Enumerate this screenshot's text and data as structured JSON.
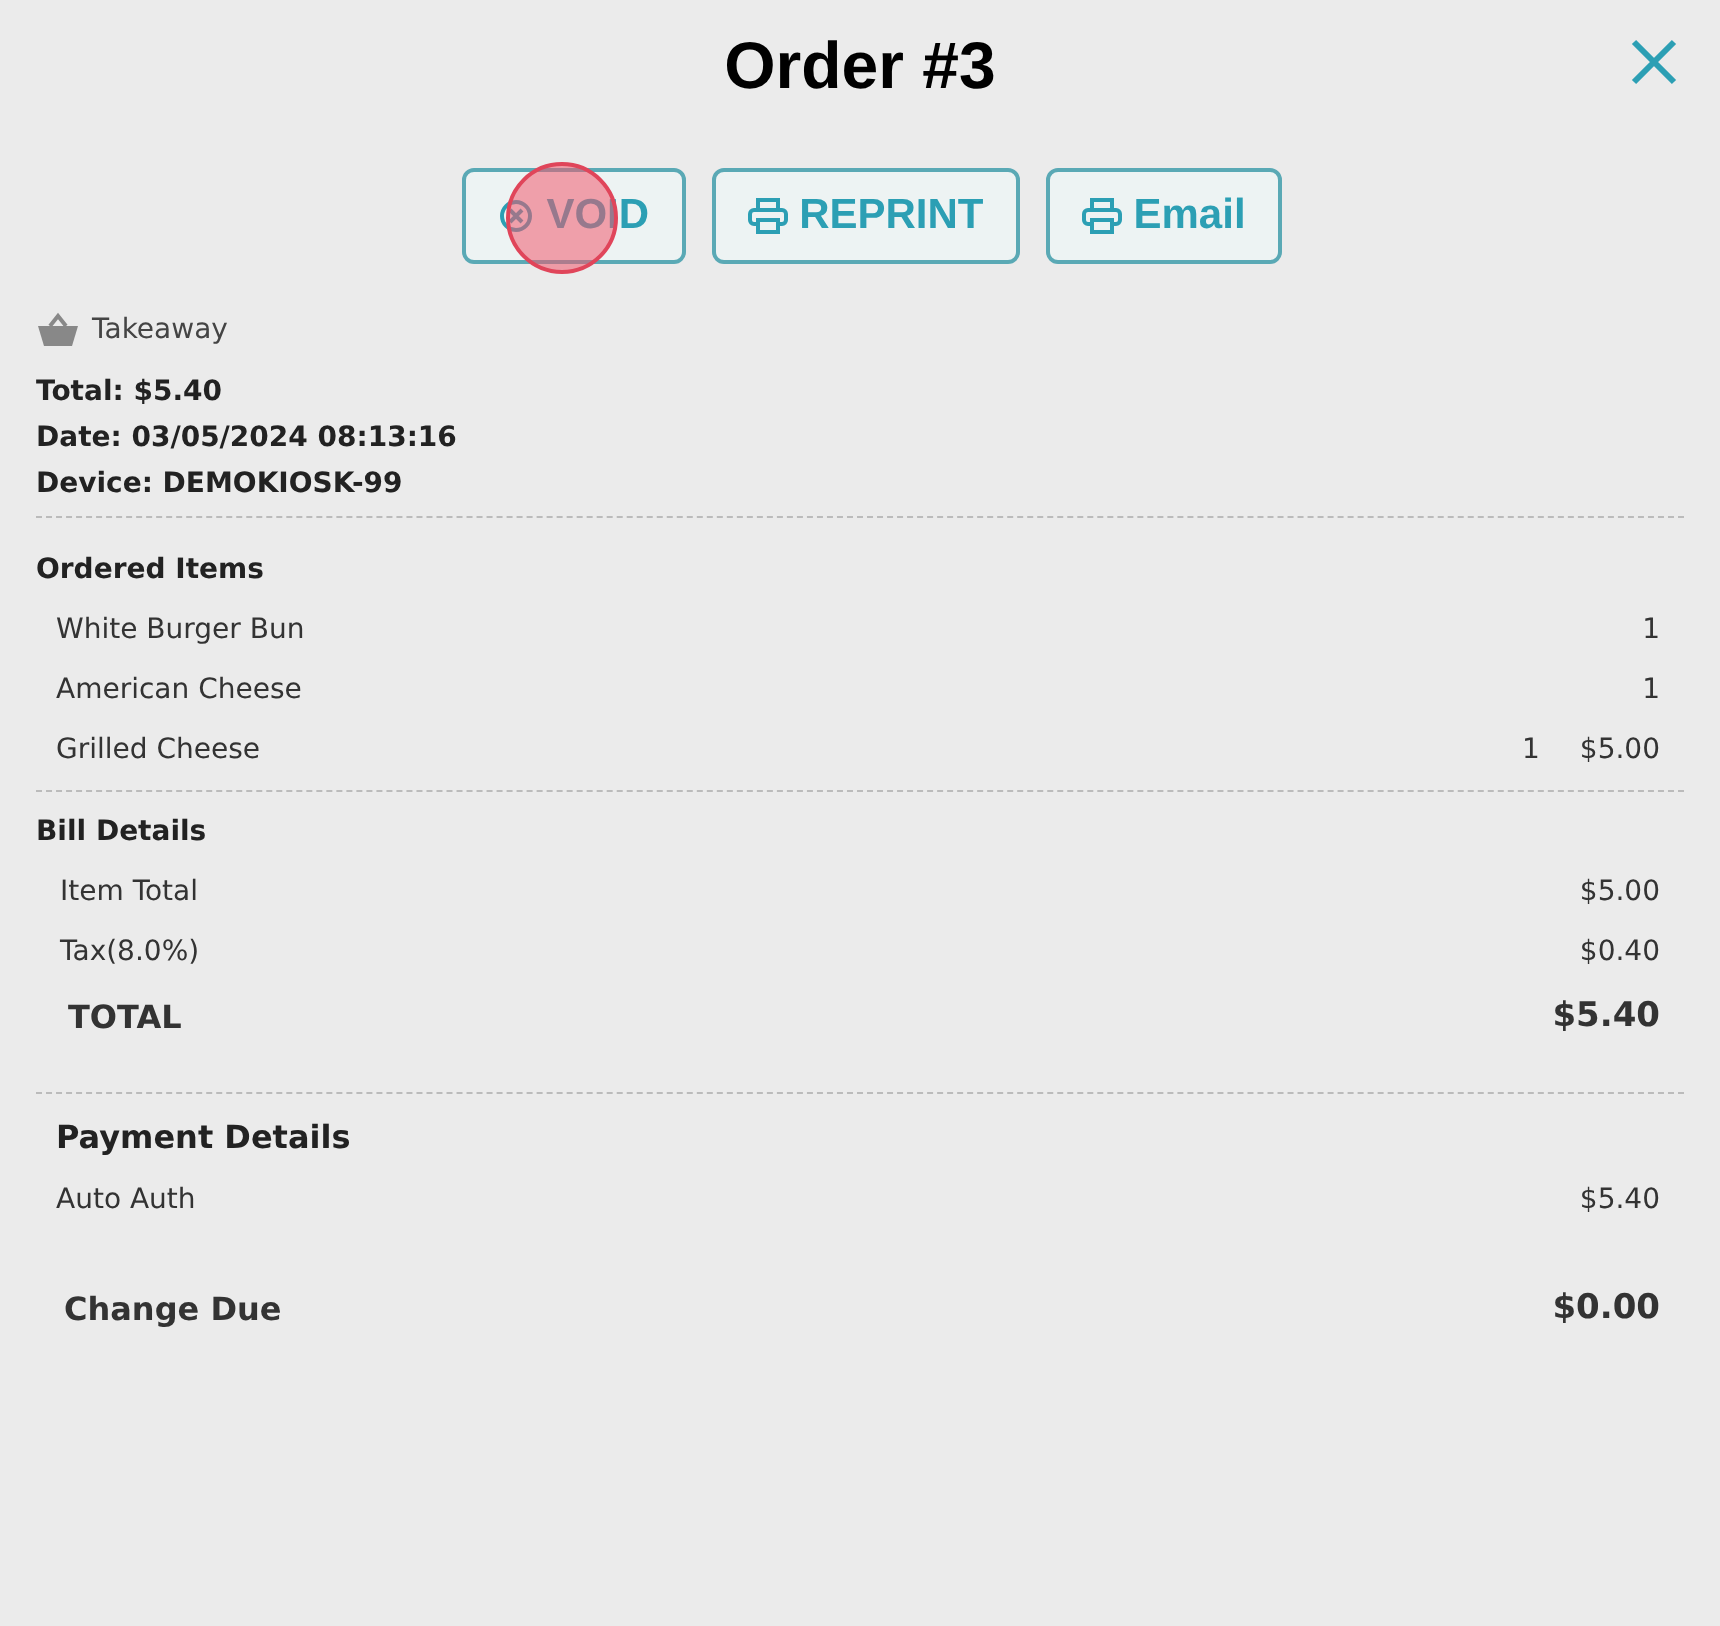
{
  "title": "Order #3",
  "actions": [
    {
      "label": "VOID",
      "kind": "void"
    },
    {
      "label": "REPRINT",
      "kind": "print"
    },
    {
      "label": "Email",
      "kind": "email"
    }
  ],
  "order_type": "Takeaway",
  "summary": [
    "Total: $5.40",
    "Date: 03/05/2024 08:13:16",
    "Device: DEMOKIOSK-99"
  ],
  "ordered_items": {
    "heading": "Ordered Items",
    "rows": [
      {
        "name": "White Burger Bun",
        "qty": "1"
      },
      {
        "name": "American Cheese",
        "qty": "1"
      },
      {
        "name": "Grilled Cheese",
        "qty": "1",
        "price": "$5.00"
      }
    ]
  },
  "bill_details": {
    "heading": "Bill Details",
    "rows": [
      {
        "label": "Item Total",
        "value": "$5.00",
        "kind": "line"
      },
      {
        "label": "Tax(8.0%)",
        "value": "$0.40",
        "kind": "line"
      },
      {
        "label": "TOTAL",
        "value": "$5.40",
        "kind": "total"
      }
    ]
  },
  "payment_details": {
    "heading": "Payment Details",
    "rows": [
      {
        "label": "Auto Auth",
        "value": "$5.40",
        "kind": "line"
      },
      {
        "label": "Change Due",
        "value": "$0.00",
        "kind": "total"
      }
    ]
  }
}
